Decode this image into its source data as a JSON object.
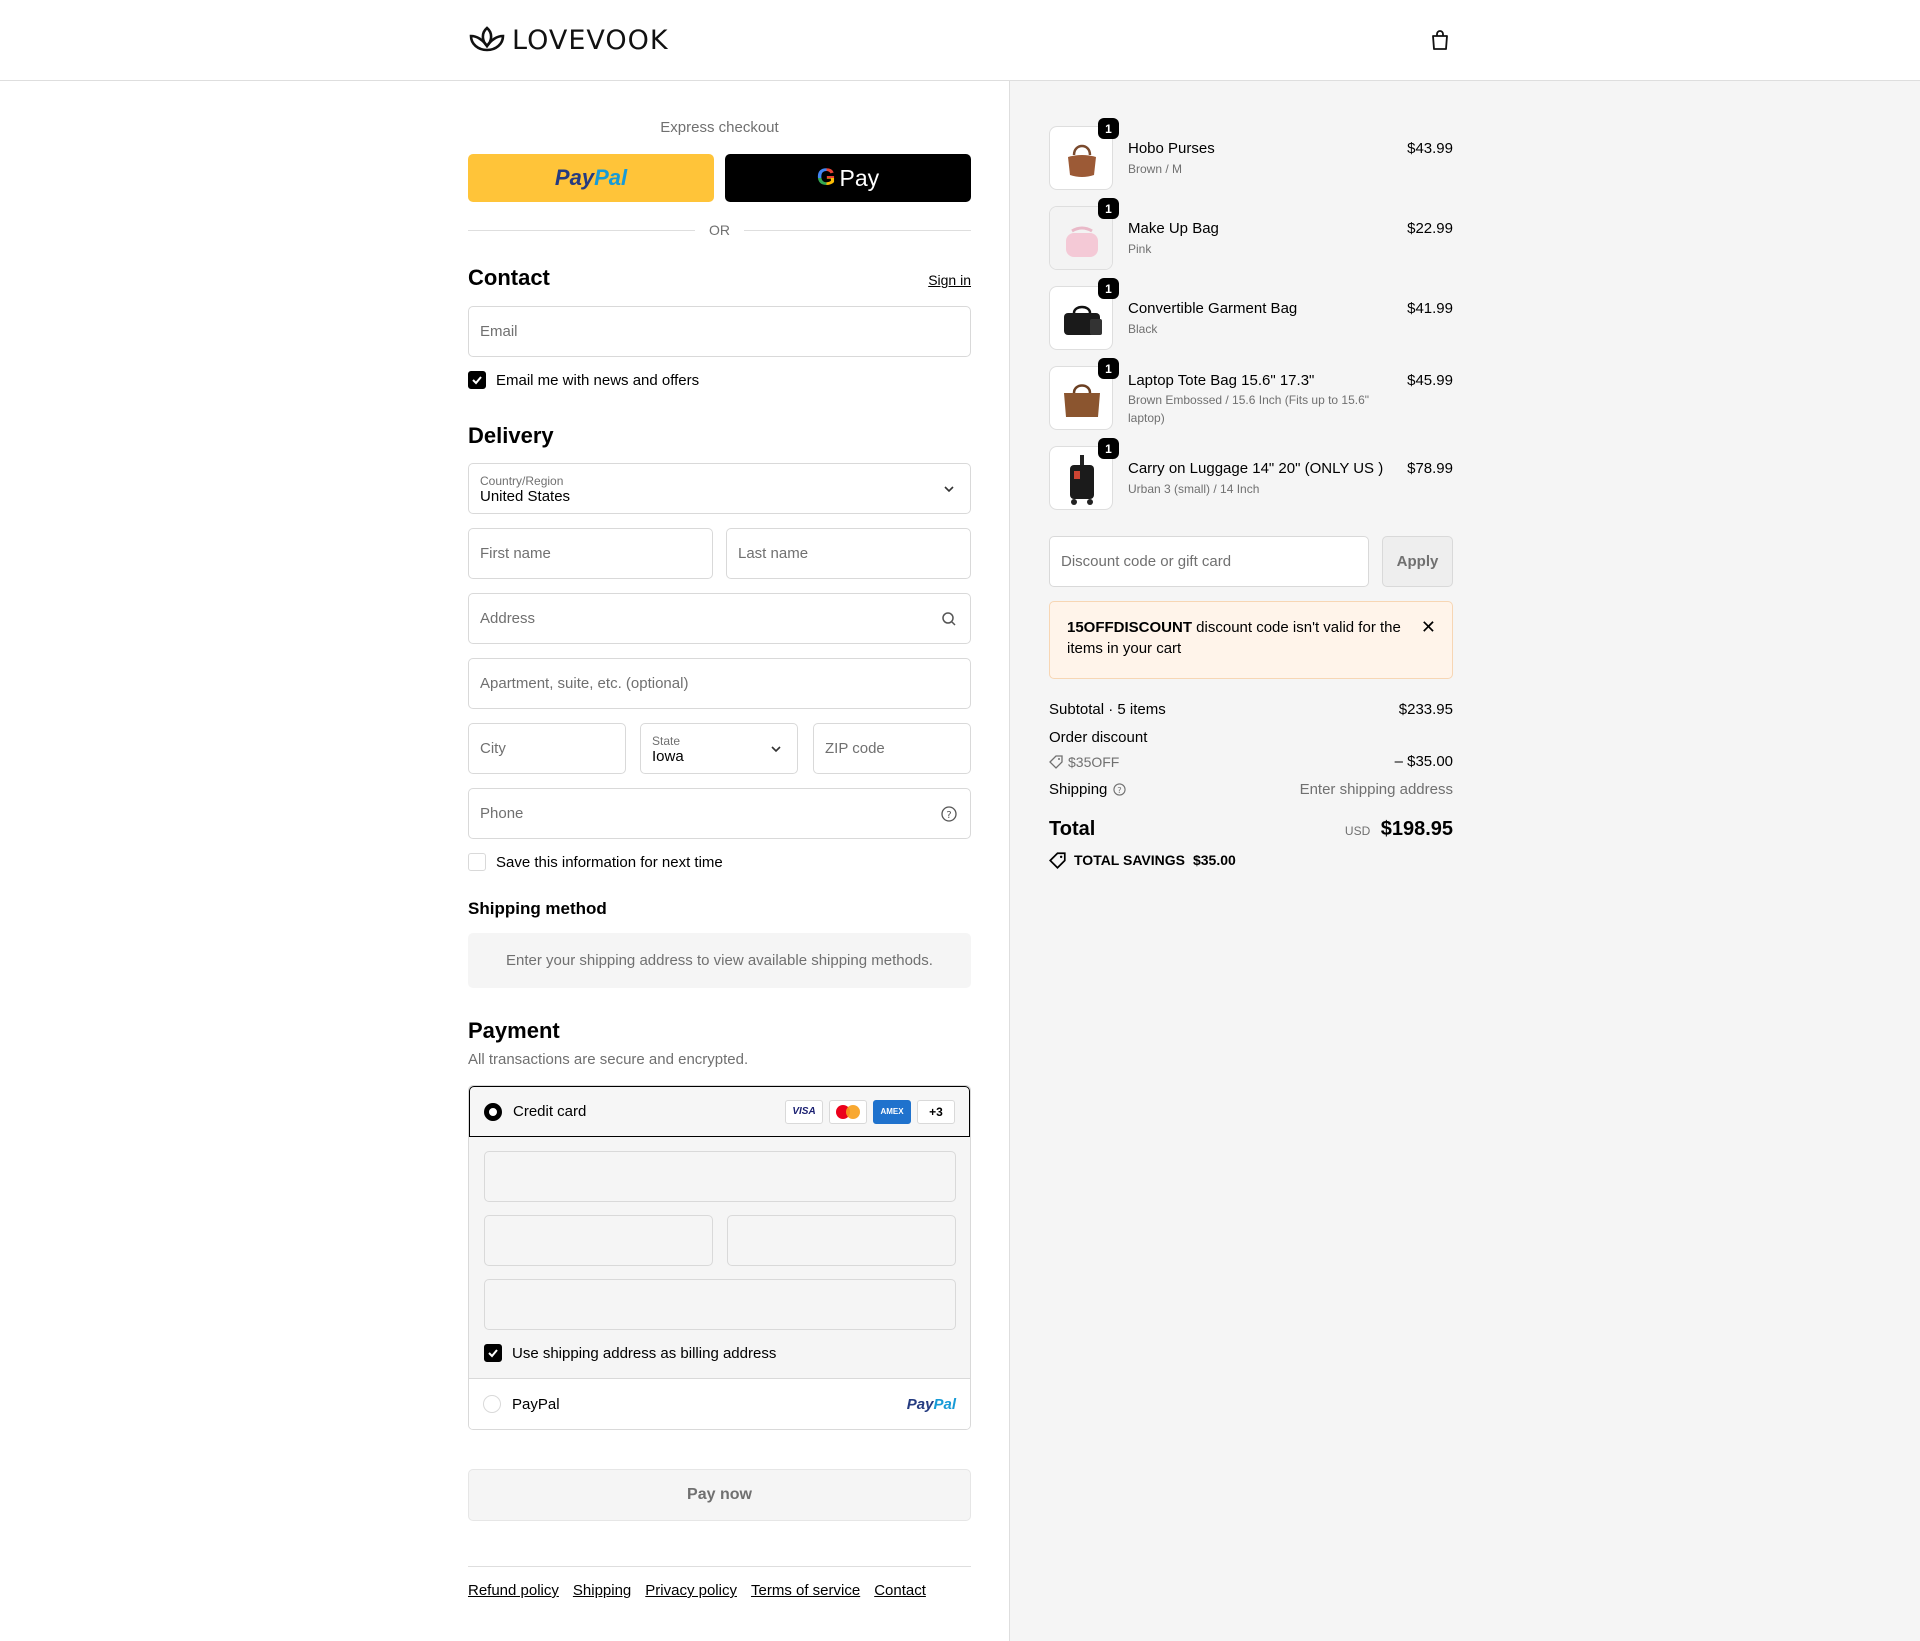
{
  "brand": {
    "name": "LOVEVOOK"
  },
  "express": {
    "label": "Express checkout",
    "paypal_a": "Pay",
    "paypal_b": "Pal",
    "gpay_g": "G",
    "gpay_label": "Pay",
    "or": "OR"
  },
  "contact": {
    "title": "Contact",
    "sign_in": "Sign in",
    "email_placeholder": "Email",
    "news_label": "Email me with news and offers",
    "news_checked": true
  },
  "delivery": {
    "title": "Delivery",
    "country_label": "Country/Region",
    "country_value": "United States",
    "first_name": "First name",
    "last_name": "Last name",
    "address": "Address",
    "apartment": "Apartment, suite, etc. (optional)",
    "city": "City",
    "state_label": "State",
    "state_value": "Iowa",
    "zip": "ZIP code",
    "phone": "Phone",
    "save_info": "Save this information for next time"
  },
  "shipping_method": {
    "title": "Shipping method",
    "message": "Enter your shipping address to view available shipping methods."
  },
  "payment": {
    "title": "Payment",
    "subtitle": "All transactions are secure and encrypted.",
    "credit_card": "Credit card",
    "badges": {
      "visa": "VISA",
      "amex": "AMEX",
      "more": "+3"
    },
    "billing_label": "Use shipping address as billing address",
    "paypal": "PayPal",
    "paypal_logo_a": "Pay",
    "paypal_logo_b": "Pal",
    "pay_now": "Pay now"
  },
  "footer": [
    "Refund policy",
    "Shipping",
    "Privacy policy",
    "Terms of service",
    "Contact"
  ],
  "items": [
    {
      "name": "Hobo Purses",
      "variant": "Brown / M",
      "price": "$43.99",
      "qty": "1"
    },
    {
      "name": "Make Up Bag",
      "variant": "Pink",
      "price": "$22.99",
      "qty": "1"
    },
    {
      "name": "Convertible Garment Bag",
      "variant": "Black",
      "price": "$41.99",
      "qty": "1"
    },
    {
      "name": "Laptop Tote Bag 15.6\" 17.3\"",
      "variant": "Brown Embossed / 15.6 Inch (Fits up to 15.6\" laptop)",
      "price": "$45.99",
      "qty": "1"
    },
    {
      "name": "Carry on Luggage 14\" 20\" (ONLY US )",
      "variant": "Urban 3 (small) / 14 Inch",
      "price": "$78.99",
      "qty": "1"
    }
  ],
  "discount": {
    "placeholder": "Discount code or gift card",
    "apply": "Apply",
    "alert_code": "15OFFDISCOUNT",
    "alert_text": " discount code isn't valid for the items in your cart"
  },
  "summary": {
    "subtotal_label": "Subtotal · 5 items",
    "subtotal_value": "$233.95",
    "order_discount_label": "Order discount",
    "discount_code": "$35OFF",
    "discount_value": "– $35.00",
    "shipping_label": "Shipping",
    "shipping_value": "Enter shipping address",
    "total_label": "Total",
    "currency": "USD",
    "total_value": "$198.95",
    "savings_label": "TOTAL SAVINGS",
    "savings_value": "$35.00"
  },
  "colors": {
    "paypal_yellow": "#ffc439",
    "alert_bg": "#fff4ea",
    "sidebar_bg": "#f5f5f5"
  }
}
